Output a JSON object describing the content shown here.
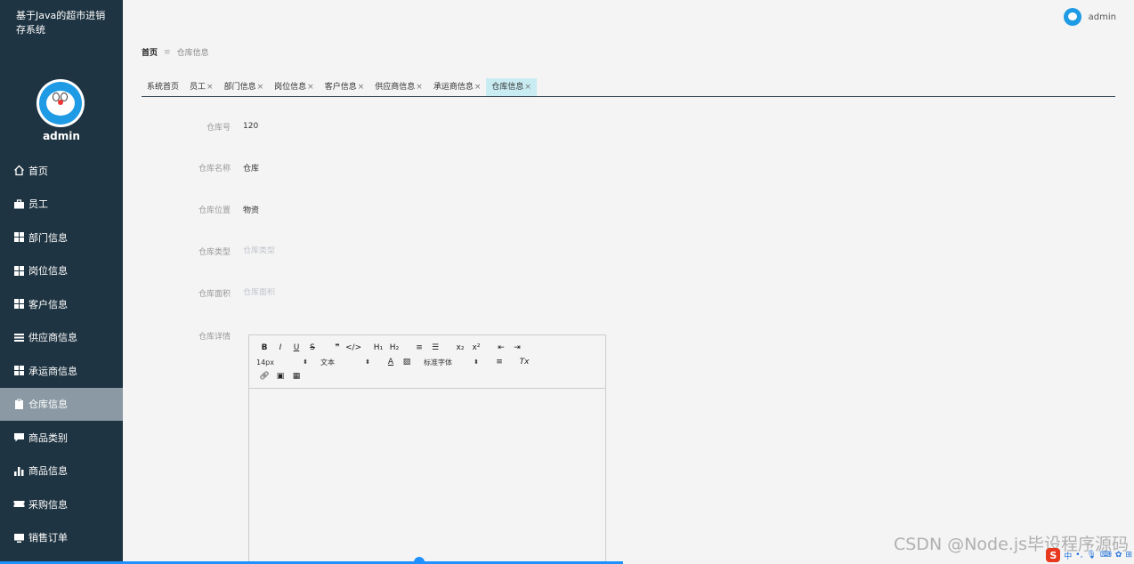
{
  "app": {
    "title": "基于Java的超市进销存系统",
    "user": "admin"
  },
  "sidebar": {
    "avatar_name": "admin",
    "items": [
      {
        "label": "首页",
        "icon": "home-icon"
      },
      {
        "label": "员工",
        "icon": "briefcase-icon"
      },
      {
        "label": "部门信息",
        "icon": "grid-icon"
      },
      {
        "label": "岗位信息",
        "icon": "grid-icon"
      },
      {
        "label": "客户信息",
        "icon": "grid-icon"
      },
      {
        "label": "供应商信息",
        "icon": "list-icon"
      },
      {
        "label": "承运商信息",
        "icon": "grid-icon"
      },
      {
        "label": "仓库信息",
        "icon": "clipboard-icon",
        "active": true
      },
      {
        "label": "商品类别",
        "icon": "comment-icon"
      },
      {
        "label": "商品信息",
        "icon": "bar-chart-icon"
      },
      {
        "label": "采购信息",
        "icon": "ticket-icon"
      },
      {
        "label": "销售订单",
        "icon": "monitor-icon"
      }
    ]
  },
  "breadcrumb": {
    "home": "首页",
    "separator": "≡",
    "current": "仓库信息"
  },
  "tabs": [
    {
      "label": "系统首页",
      "closable": false
    },
    {
      "label": "员工",
      "closable": true
    },
    {
      "label": "部门信息",
      "closable": true
    },
    {
      "label": "岗位信息",
      "closable": true
    },
    {
      "label": "客户信息",
      "closable": true
    },
    {
      "label": "供应商信息",
      "closable": true
    },
    {
      "label": "承运商信息",
      "closable": true
    },
    {
      "label": "仓库信息",
      "closable": true,
      "active": true
    }
  ],
  "form": {
    "fields": [
      {
        "label": "仓库号",
        "value": "120",
        "placeholder": ""
      },
      {
        "label": "仓库名称",
        "value": "仓库",
        "placeholder": ""
      },
      {
        "label": "仓库位置",
        "value": "物资",
        "placeholder": ""
      },
      {
        "label": "仓库类型",
        "value": "",
        "placeholder": "仓库类型"
      },
      {
        "label": "仓库面积",
        "value": "",
        "placeholder": "仓库面积"
      }
    ],
    "details_label": "仓库详情"
  },
  "editor": {
    "row1": [
      "B",
      "I",
      "U",
      "S",
      "❞",
      "</>",
      "H₁",
      "H₂",
      "≡",
      "☰",
      "x₂",
      "x²",
      "⇤",
      "⇥"
    ],
    "font_size": "14px",
    "text_style": "文本",
    "font_family": "标准字体",
    "color_icon": "A",
    "clear_format": "Tx"
  },
  "watermark": "CSDN @Node.js毕设程序源码",
  "tray": {
    "ime": "中"
  },
  "colors": {
    "sidebar_bg": "#1f3442",
    "active_menu": "#8a99a3",
    "active_tab": "#c9ecf3",
    "accent": "#1e9be4"
  }
}
